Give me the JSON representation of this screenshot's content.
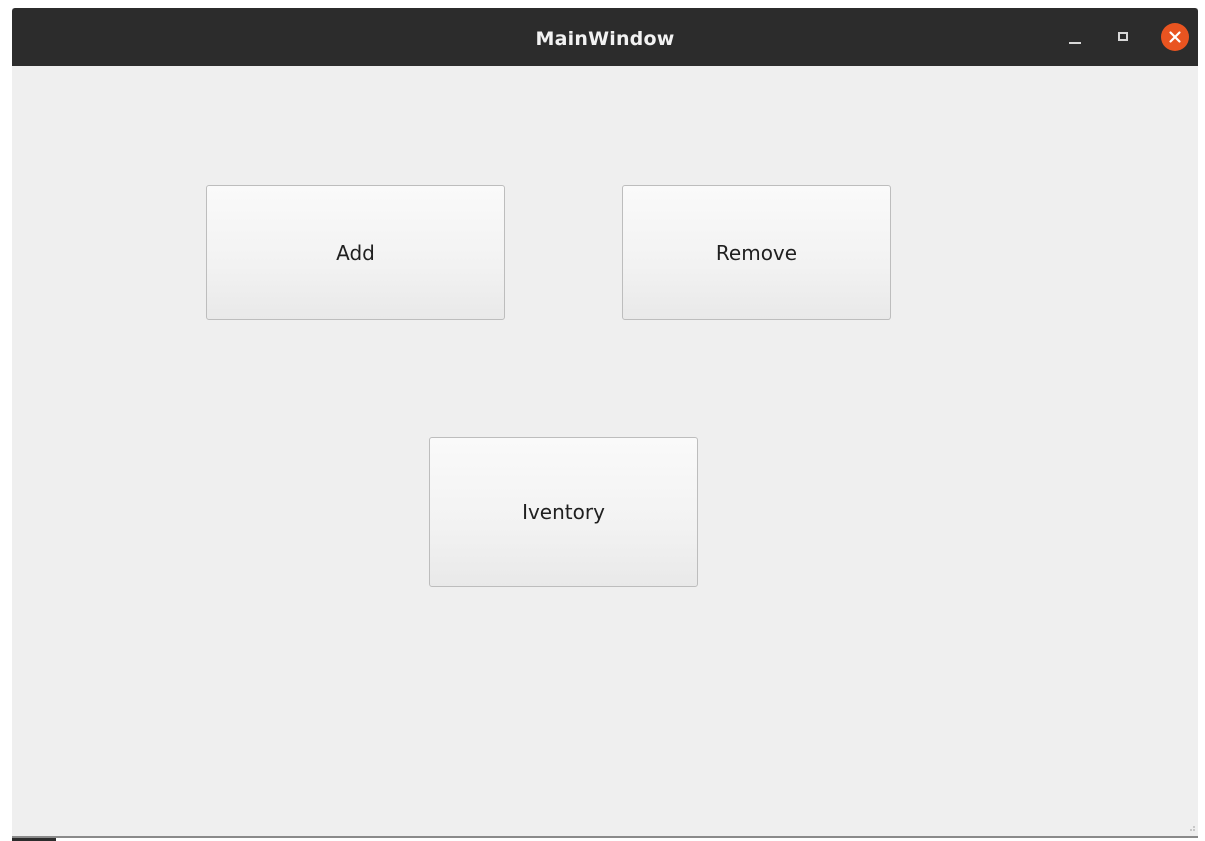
{
  "window": {
    "title": "MainWindow"
  },
  "buttons": {
    "add_label": "Add",
    "remove_label": "Remove",
    "inventory_label": "Iventory"
  },
  "colors": {
    "titlebar": "#2c2c2c",
    "window_bg": "#efefef",
    "close_accent": "#e95420"
  },
  "icons": {
    "minimize": "minimize-icon",
    "maximize": "maximize-icon",
    "close": "close-icon"
  }
}
